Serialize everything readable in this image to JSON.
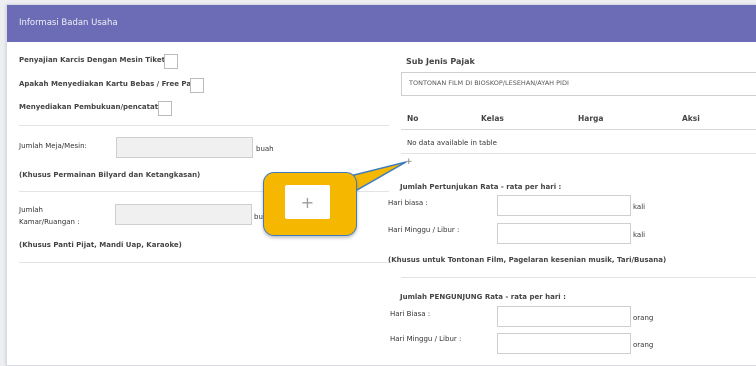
{
  "header": {
    "title": "Informasi Badan Usaha"
  },
  "left": {
    "q1": "Penyajian Karcis Dengan Mesin Tiket ?",
    "q2": "Apakah Menyediakan Kartu Bebas / Free Pass:",
    "q3": "Menyediakan Pembukuan/pencatatan",
    "meja_label": "Jumlah Meja/Mesin:",
    "meja_unit": "buah",
    "note1": "(Khusus Permainan Bilyard dan Ketangkasan)",
    "kamar_label_1": "Jumlah",
    "kamar_label_2": "Kamar/Ruangan :",
    "kamar_unit": "buah",
    "note2": "(Khusus Panti Pijat, Mandi Uap, Karaoke)"
  },
  "right": {
    "sub_jenis_label": "Sub Jenis Pajak",
    "sub_jenis_value": "TONTONAN FILM DI BIOSKOP/LESEHAN/AYAH PIDI",
    "table_headers": [
      "No",
      "Kelas",
      "Harga",
      "Aksi"
    ],
    "empty_text": "No data available in table",
    "add_symbol": "+",
    "pertunjukan_title": "Jumlah Pertunjukan Rata - rata per hari :",
    "hari_biasa_label": "Hari biasa :",
    "kali_1": "kali",
    "hari_minggu_label": "Hari Minggu / Libur :",
    "kali_2": "kali",
    "note3": "(Khusus untuk Tontonan Film, Pagelaran kesenian musik, Tari/Busana)",
    "pengunjung_title": "Jumlah PENGUNJUNG Rata - rata per hari :",
    "pengunjung_hari_biasa_label": "Hari Biasa :",
    "orang_1": "orang",
    "pengunjung_hari_minggu_label": "Hari Minggu / Libur :",
    "orang_2": "orang"
  },
  "callout": {
    "symbol": "+"
  }
}
